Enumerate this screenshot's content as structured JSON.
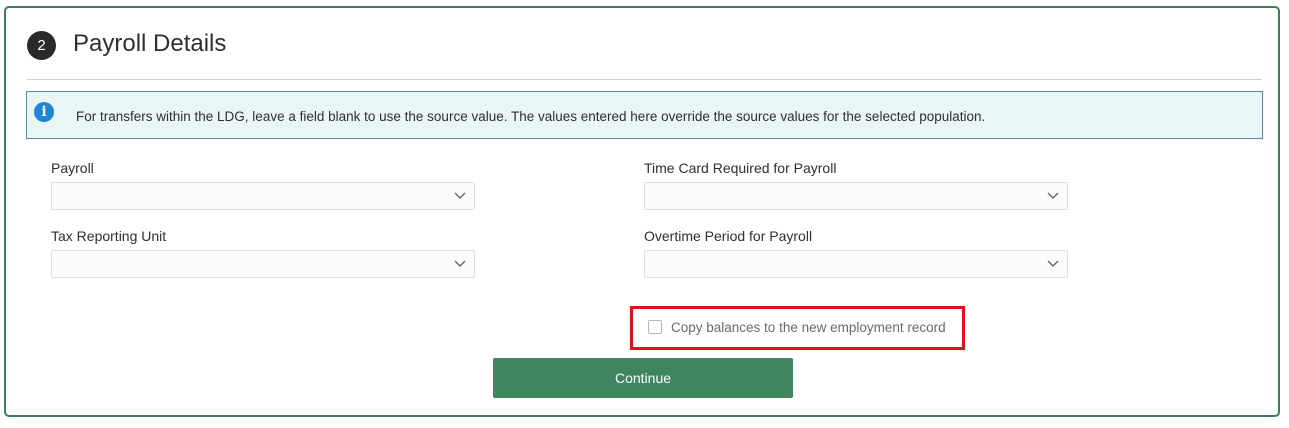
{
  "section": {
    "step_number": "2",
    "title": "Payroll Details"
  },
  "info": {
    "icon": "info-icon",
    "message": "For transfers within the LDG, leave a field blank to use the source value. The values entered here override the source values for the selected population."
  },
  "fields": {
    "payroll": {
      "label": "Payroll",
      "value": ""
    },
    "tax_reporting_unit": {
      "label": "Tax Reporting Unit",
      "value": ""
    },
    "time_card_required": {
      "label": "Time Card Required for Payroll",
      "value": ""
    },
    "overtime_period": {
      "label": "Overtime Period for Payroll",
      "value": ""
    }
  },
  "copy_balances": {
    "label": "Copy balances to the new employment record",
    "checked": false
  },
  "continue_label": "Continue",
  "colors": {
    "accent": "#3f8660",
    "highlight": "#e0111c",
    "info_icon": "#1d87d3"
  }
}
